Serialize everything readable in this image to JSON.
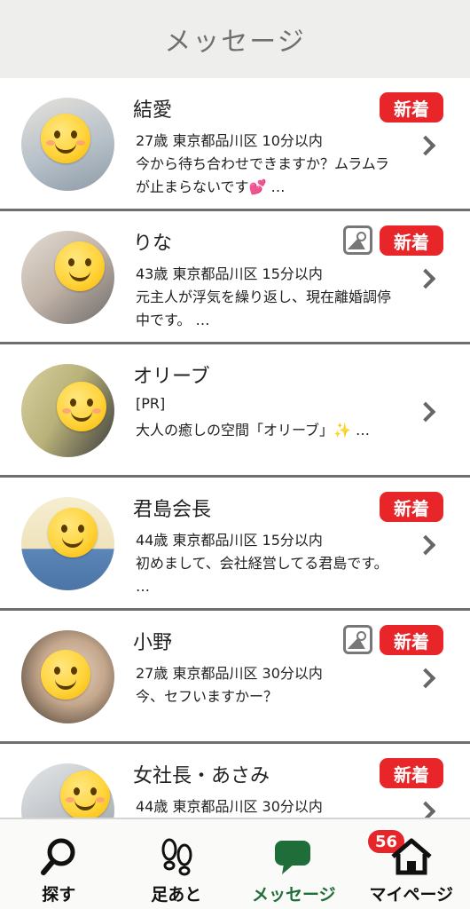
{
  "header": {
    "title": "メッセージ"
  },
  "messages": [
    {
      "name": "結愛",
      "meta": "27歳  東京都品川区  10分以内",
      "message": "今から待ち合わせできますか？ムラムラが止まらないです💕 …",
      "new_label": "新着",
      "has_photo": false,
      "bg": "#c9cfd4"
    },
    {
      "name": "りな",
      "meta": "43歳  東京都品川区  15分以内",
      "message": "元主人が浮気を繰り返し、現在離婚調停中です。 …",
      "new_label": "新着",
      "has_photo": true,
      "bg": "#cfc7c0"
    },
    {
      "name": "オリーブ",
      "pr": "[PR]",
      "message": "大人の癒しの空間「オリーブ」✨ …",
      "new_label": "",
      "has_photo": false,
      "bg": "#cfc9a3"
    },
    {
      "name": "君島会長",
      "meta": "44歳  東京都品川区  15分以内",
      "message": "初めまして、会社経営してる君島です。 …",
      "new_label": "新着",
      "has_photo": false,
      "bg": "#f2e9c6"
    },
    {
      "name": "小野",
      "meta": "27歳  東京都品川区  30分以内",
      "message": "今、セフいますかー？",
      "new_label": "新着",
      "has_photo": true,
      "bg": "#c9b9a6"
    },
    {
      "name": "女社長・あさみ",
      "meta": "44歳  東京都品川区  30分以内",
      "message": "",
      "new_label": "新着",
      "has_photo": false,
      "bg": "#d9dcdf"
    }
  ],
  "tabs": [
    {
      "label": "探す",
      "icon": "search-icon",
      "active": false
    },
    {
      "label": "足あと",
      "icon": "footprints-icon",
      "active": false
    },
    {
      "label": "メッセージ",
      "icon": "chat-bubble-icon",
      "active": true,
      "badge": "56"
    },
    {
      "label": "マイページ",
      "icon": "home-icon",
      "active": false
    }
  ],
  "colors": {
    "accent_red": "#e8262a",
    "active_green": "#1f6e3a",
    "header_bg": "#eeeeec"
  }
}
